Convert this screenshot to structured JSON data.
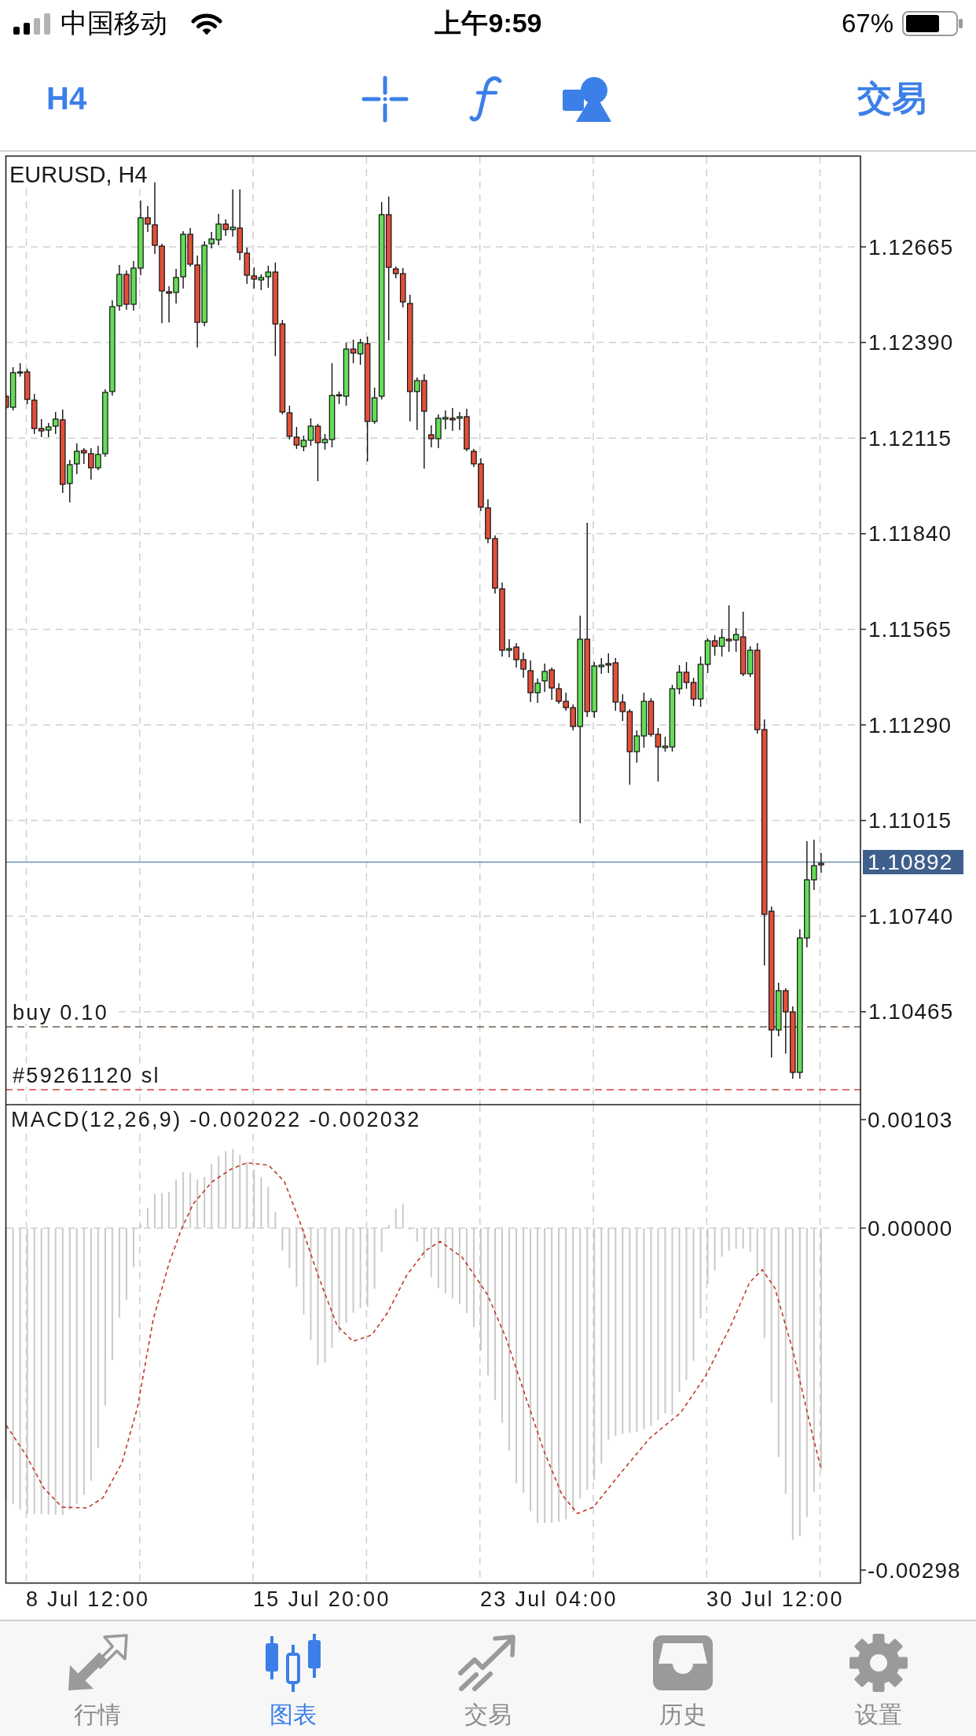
{
  "status_bar": {
    "carrier": "中国移动",
    "time": "上午9:59",
    "battery": "67%"
  },
  "toolbar": {
    "timeframe": "H4",
    "trade": "交易"
  },
  "chart": {
    "symbol": "EURUSD, H4",
    "price_ticks": [
      "1.12665",
      "1.12390",
      "1.12115",
      "1.11840",
      "1.11565",
      "1.11290",
      "1.11015",
      "1.10740",
      "1.10465"
    ],
    "current_price": "1.10892",
    "orders": [
      {
        "kind": "entry",
        "label": "buy 0.10"
      },
      {
        "kind": "stop_loss",
        "label": "#59261120 sl"
      }
    ],
    "macd": {
      "label": "MACD(12,26,9) -0.002022 -0.002032",
      "ticks": [
        "0.00103",
        "0.00000",
        "-0.00298"
      ]
    },
    "time_labels": [
      "8 Jul 12:00",
      "15 Jul 20:00",
      "23 Jul 04:00",
      "30 Jul 12:00"
    ]
  },
  "tab_bar": [
    {
      "label": "行情",
      "selected": false
    },
    {
      "label": "图表",
      "selected": true
    },
    {
      "label": "交易",
      "selected": false
    },
    {
      "label": "历史",
      "selected": false
    },
    {
      "label": "设置",
      "selected": false
    }
  ]
}
